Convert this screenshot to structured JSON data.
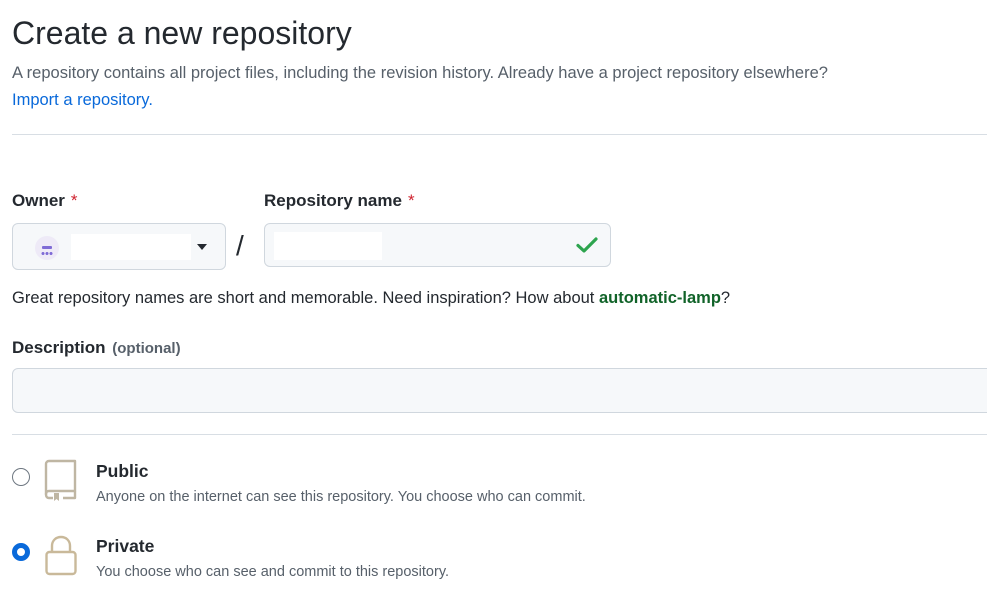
{
  "header": {
    "title": "Create a new repository",
    "subtitle": "A repository contains all project files, including the revision history. Already have a project repository elsewhere?",
    "import_link": "Import a repository."
  },
  "form": {
    "owner_label": "Owner",
    "repo_label": "Repository name",
    "required_marker": "*",
    "slash": "/",
    "hint_prefix": "Great repository names are short and memorable. Need inspiration? How about ",
    "hint_suggestion": "automatic-lamp",
    "hint_suffix": "?",
    "description_label": "Description",
    "description_optional": "(optional)",
    "description_value": ""
  },
  "visibility": {
    "options": [
      {
        "title": "Public",
        "description": "Anyone on the internet can see this repository. You choose who can commit.",
        "icon": "repo-icon",
        "selected": false
      },
      {
        "title": "Private",
        "description": "You choose who can see and commit to this repository.",
        "icon": "lock-icon",
        "selected": true
      }
    ]
  },
  "colors": {
    "link": "#0969da",
    "required": "#cf222e",
    "suggestion": "#116329",
    "check": "#2da44e",
    "avatar_accent": "#7f6bd6",
    "icon_stroke": "#c9b99a"
  }
}
